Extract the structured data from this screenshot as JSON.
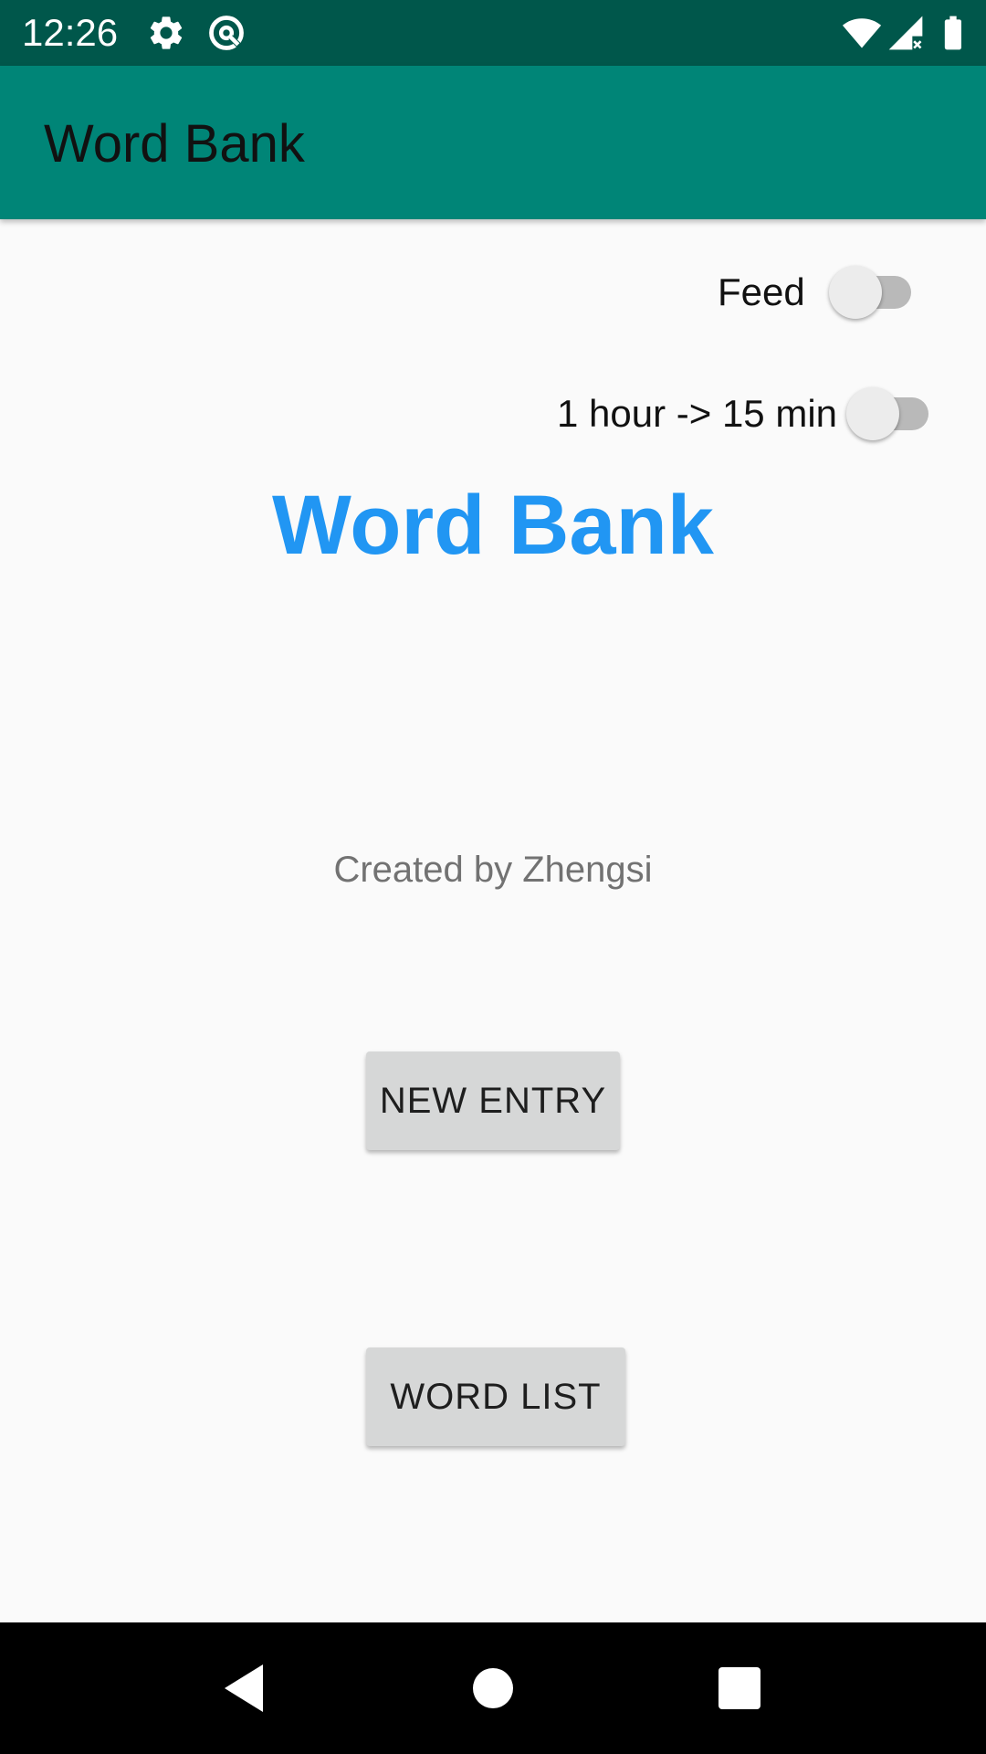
{
  "status_bar": {
    "time": "12:26",
    "left_icons": [
      "settings-icon",
      "data-saver-icon"
    ],
    "right_icons": [
      "wifi-icon",
      "cell-signal-icon",
      "battery-icon"
    ]
  },
  "app_bar": {
    "title": "Word Bank"
  },
  "switches": [
    {
      "label": "Feed",
      "checked": false
    },
    {
      "label": "1 hour -> 15 min",
      "checked": false
    }
  ],
  "main": {
    "title": "Word Bank",
    "credit": "Created by Zhengsi",
    "new_entry_button": "NEW ENTRY",
    "word_list_button": "WORD LIST"
  },
  "nav_bar": {
    "buttons": [
      "back-icon",
      "home-icon",
      "recents-icon"
    ]
  },
  "colors": {
    "status_bar": "#00574b",
    "app_bar": "#008577",
    "accent_title": "#2196f3",
    "button_bg": "#d6d7d7",
    "background": "#fafafa"
  }
}
